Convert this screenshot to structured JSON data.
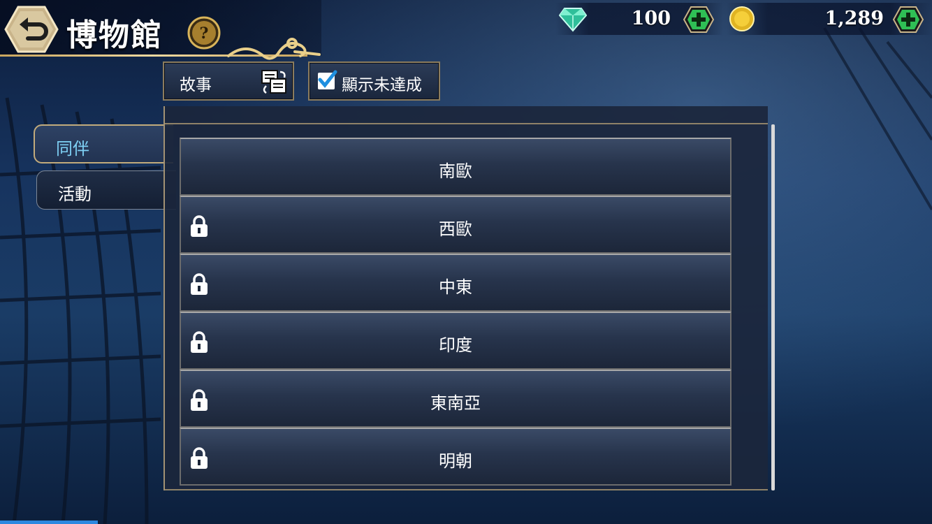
{
  "header": {
    "title": "博物館"
  },
  "currencies": {
    "gems": "100",
    "coins": "1,289"
  },
  "filters": {
    "story_label": "故事",
    "show_unfinished_label": "顯示未達成",
    "show_unfinished_checked": true
  },
  "tabs": [
    {
      "label": "同伴",
      "active": true
    },
    {
      "label": "活動",
      "active": false
    }
  ],
  "regions": [
    {
      "label": "南歐",
      "locked": false
    },
    {
      "label": "西歐",
      "locked": true
    },
    {
      "label": "中東",
      "locked": true
    },
    {
      "label": "印度",
      "locked": true
    },
    {
      "label": "東南亞",
      "locked": true
    },
    {
      "label": "明朝",
      "locked": true
    }
  ],
  "colors": {
    "accent_gold": "#c9a55d",
    "active_tab_text": "#7ed0f4",
    "plus_green": "#2fbf55"
  }
}
